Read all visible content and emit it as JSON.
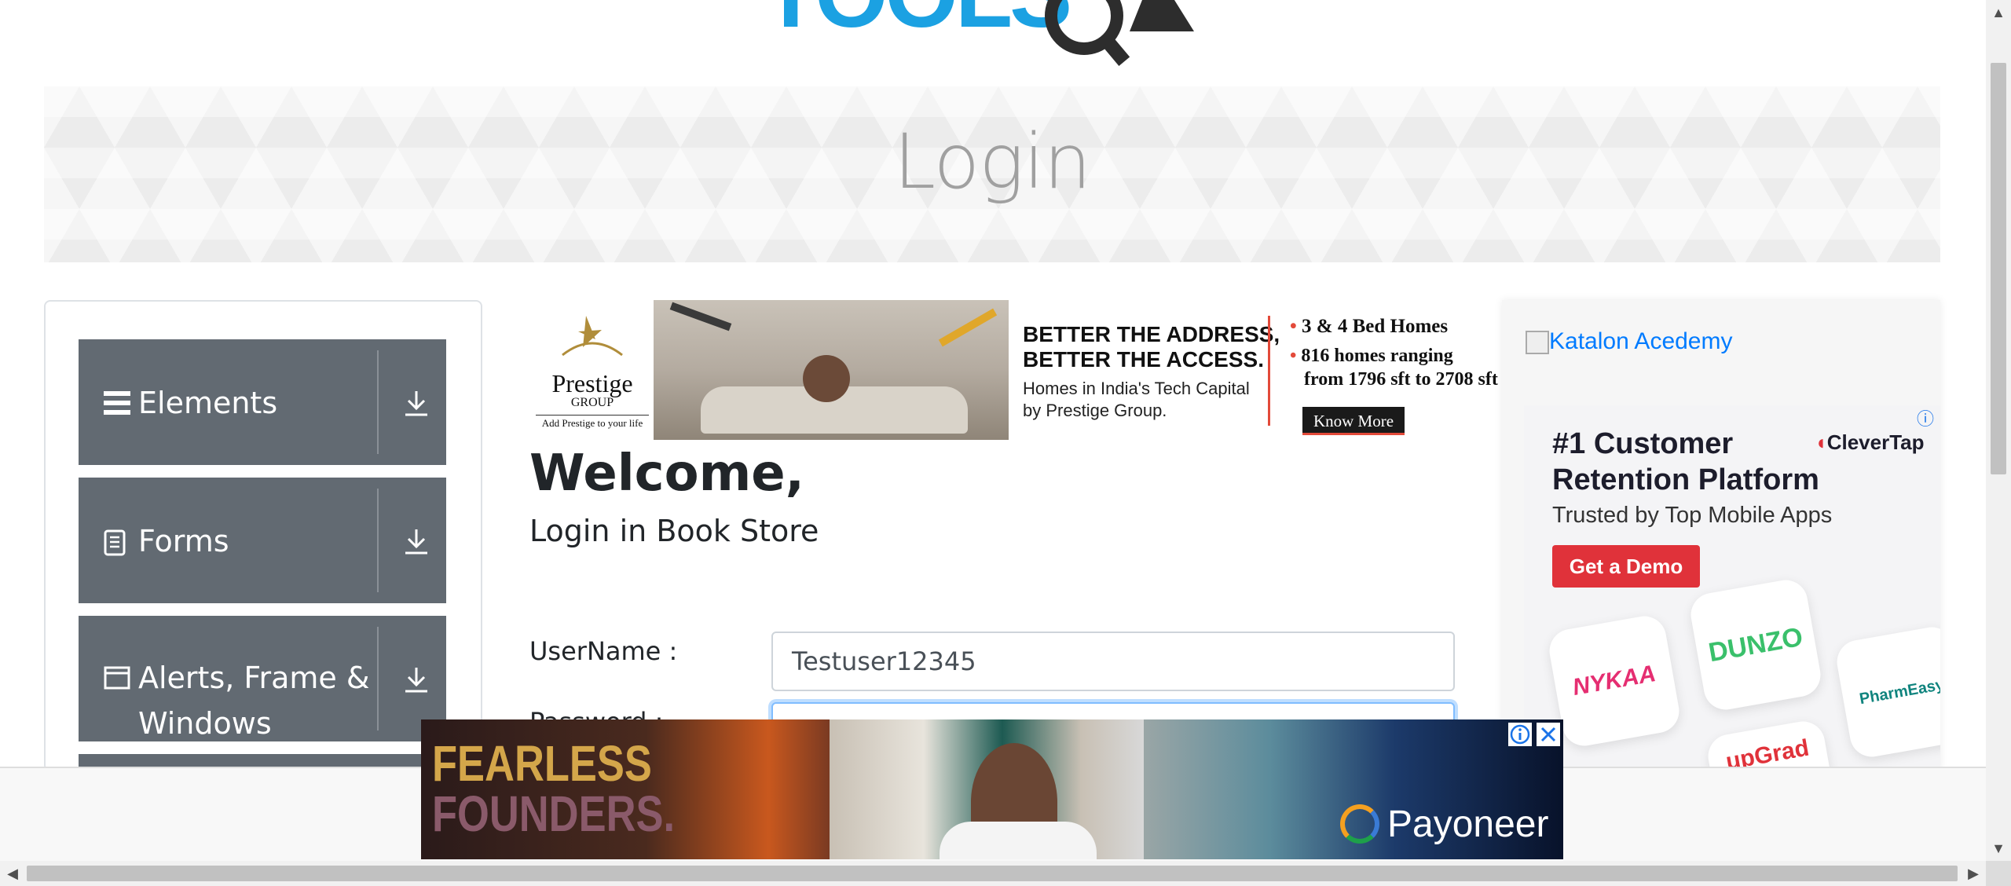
{
  "logo": {
    "text": "TOOLSQA"
  },
  "banner": {
    "title": "Login"
  },
  "sidebar": {
    "groups": [
      {
        "label": "Elements",
        "icon": "hamburger-icon"
      },
      {
        "label": "Forms",
        "icon": "document-icon"
      },
      {
        "label_line1": "Alerts, Frame &",
        "label_line2": "Windows",
        "icon": "window-icon"
      }
    ]
  },
  "top_ad": {
    "brand": "Prestige",
    "brand_sub": "GROUP",
    "tagline": "Add Prestige to your life",
    "headline1": "BETTER THE ADDRESS,",
    "headline2": "BETTER THE ACCESS.",
    "body1": "Homes in India's Tech Capital",
    "body2": "by Prestige Group.",
    "bullet1": "3 & 4  Bed Homes",
    "bullet2a": "816 homes ranging",
    "bullet2b": "from 1796 sft to 2708 sft",
    "cta": "Know More"
  },
  "main": {
    "welcome": "Welcome,",
    "subtitle": "Login in Book Store",
    "username_label": "UserName :",
    "username_value": "Testuser12345",
    "password_label": "Password :"
  },
  "right_ad": {
    "katalon_alt": "Katalon Acedemy",
    "headline1": "#1 Customer",
    "headline2": "Retention Platform",
    "sub": "Trusted by Top Mobile Apps",
    "cta": "Get a Demo",
    "brand": "CleverTap",
    "apps": [
      "NYKAA",
      "DUNZO",
      "PharmEasy",
      "upGrad"
    ]
  },
  "bottom_ad": {
    "line1": "FEARLESS",
    "line2": "FOUNDERS.",
    "brand": "Payoneer"
  },
  "colors": {
    "sidebar_group_bg": "#626a72",
    "link": "#007bff",
    "clevertap_red": "#e0323a",
    "logo_blue": "#1ba1e2"
  }
}
